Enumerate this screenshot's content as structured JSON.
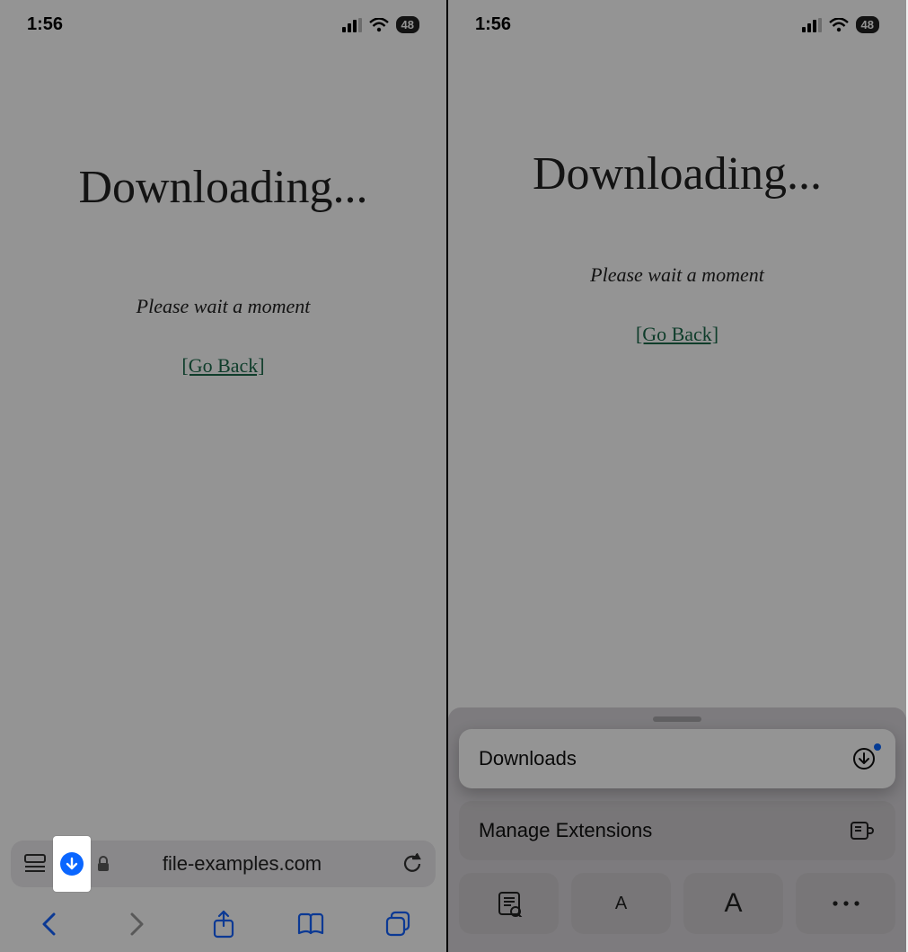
{
  "status": {
    "time": "1:56",
    "battery": "48"
  },
  "page": {
    "heading": "Downloading...",
    "wait": "Please wait a moment",
    "goback": "[Go Back]"
  },
  "left": {
    "url": "file-examples.com"
  },
  "right": {
    "sheet": {
      "downloads": "Downloads",
      "manage": "Manage Extensions",
      "smallA": "A",
      "bigA": "A"
    }
  }
}
